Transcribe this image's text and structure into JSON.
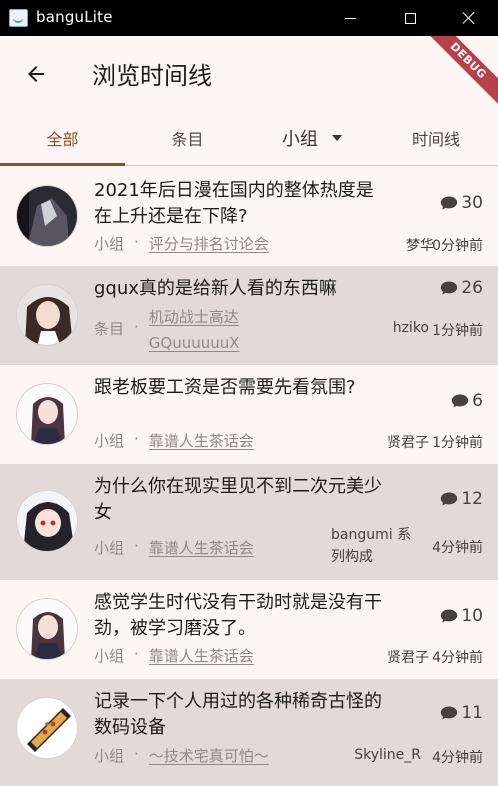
{
  "window": {
    "title": "banguLite"
  },
  "appbar": {
    "title": "浏览时间线",
    "debug_label": "DEBUG"
  },
  "tabs": [
    {
      "label": "全部",
      "selected": true
    },
    {
      "label": "条目",
      "selected": false
    },
    {
      "label": "小组",
      "selected": false,
      "has_dropdown": true
    },
    {
      "label": "时间线",
      "selected": false
    }
  ],
  "colors": {
    "accent": "#8a5020",
    "alt_row": "#e1dad8",
    "background": "#fdf6f4"
  },
  "posts": [
    {
      "title": "2021年后日漫在国内的整体热度是在上升还是在下降?",
      "category": "小组",
      "separator": "·",
      "group": "评分与排名讨论会",
      "comments": "30",
      "author": "梦华",
      "time": "0分钟前"
    },
    {
      "title": "gqux真的是给新人看的东西嘛",
      "category": "条目",
      "separator": "·",
      "group": "机动战士高达GQuuuuuuX",
      "comments": "26",
      "author": "hziko",
      "time": "1分钟前"
    },
    {
      "title": "跟老板要工资是否需要先看氛围?",
      "category": "小组",
      "separator": "·",
      "group": "靠谱人生茶话会",
      "comments": "6",
      "author": "贤君子",
      "time": "1分钟前"
    },
    {
      "title": "为什么你在现实里见不到二次元美少女",
      "category": "小组",
      "separator": "·",
      "group": "靠谱人生茶话会",
      "comments": "12",
      "author": "bangumi 系列构成",
      "time": "4分钟前"
    },
    {
      "title": "感觉学生时代没有干劲时就是没有干劲，被学习磨没了。",
      "category": "小组",
      "separator": "·",
      "group": "靠谱人生茶话会",
      "comments": "10",
      "author": "贤君子",
      "time": "4分钟前"
    },
    {
      "title": "记录一下个人用过的各种稀奇古怪的数码设备",
      "category": "小组",
      "separator": "·",
      "group": "～技术宅真可怕～",
      "comments": "11",
      "author": "Skyline_R",
      "time": "4分钟前"
    }
  ]
}
